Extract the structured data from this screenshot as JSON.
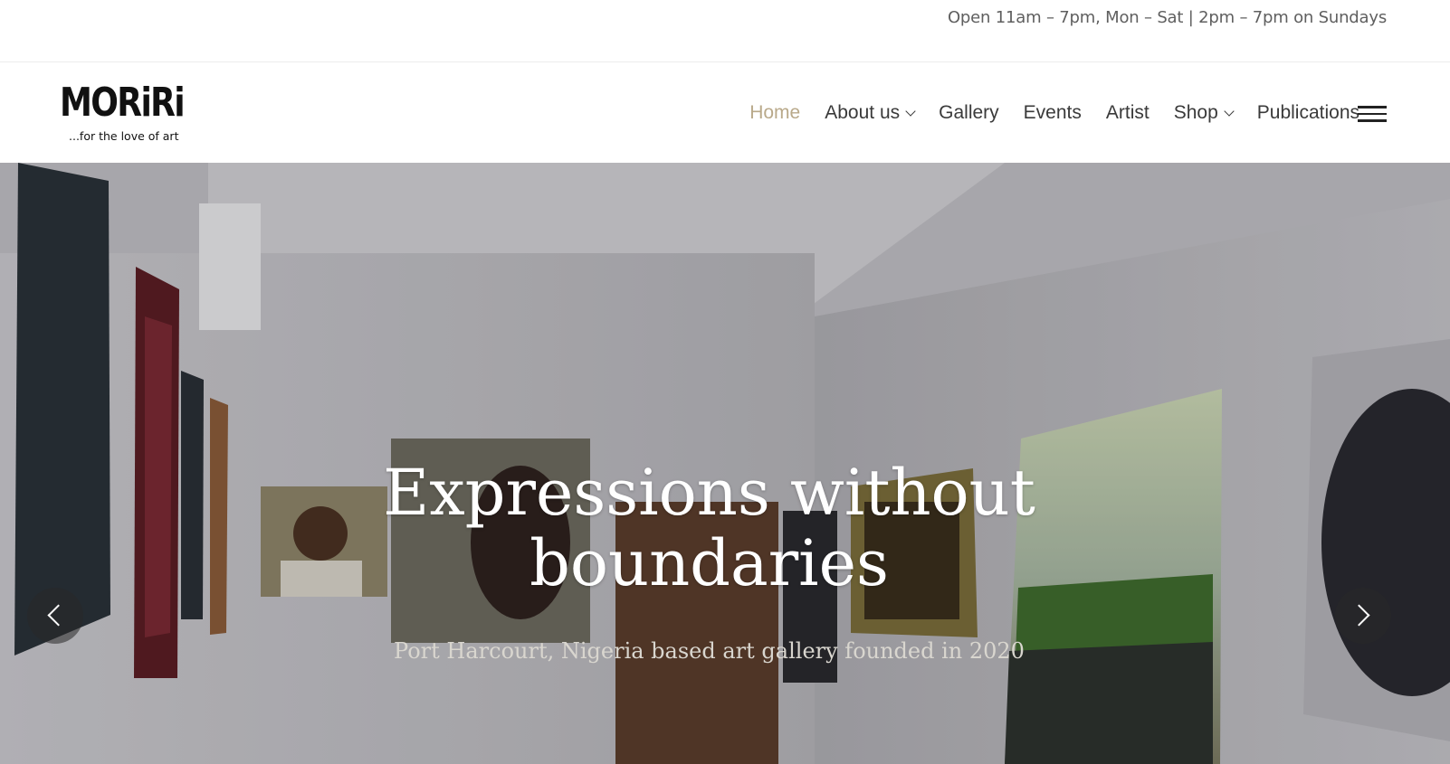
{
  "topbar": {
    "hours": "Open 11am – 7pm, Mon – Sat | 2pm – 7pm on Sundays"
  },
  "brand": {
    "name": "MORiRi",
    "tagline": "...for the love of art"
  },
  "nav": {
    "items": [
      {
        "label": "Home",
        "active": true,
        "dropdown": false
      },
      {
        "label": "About us",
        "active": false,
        "dropdown": true
      },
      {
        "label": "Gallery",
        "active": false,
        "dropdown": false
      },
      {
        "label": "Events",
        "active": false,
        "dropdown": false
      },
      {
        "label": "Artist",
        "active": false,
        "dropdown": false
      },
      {
        "label": "Shop",
        "active": false,
        "dropdown": true
      },
      {
        "label": "Publications",
        "active": false,
        "dropdown": false
      }
    ],
    "menu_icon": "hamburger-icon"
  },
  "hero": {
    "title_line1": "Expressions without",
    "title_line2": "boundaries",
    "subtitle": "Port Harcourt, Nigeria based art gallery founded in 2020",
    "prev_icon": "chevron-left-icon",
    "next_icon": "chevron-right-icon"
  },
  "colors": {
    "accent": "#b9a98a",
    "nav_text": "#3a3a3a",
    "hours_text": "#5f5f5f"
  }
}
